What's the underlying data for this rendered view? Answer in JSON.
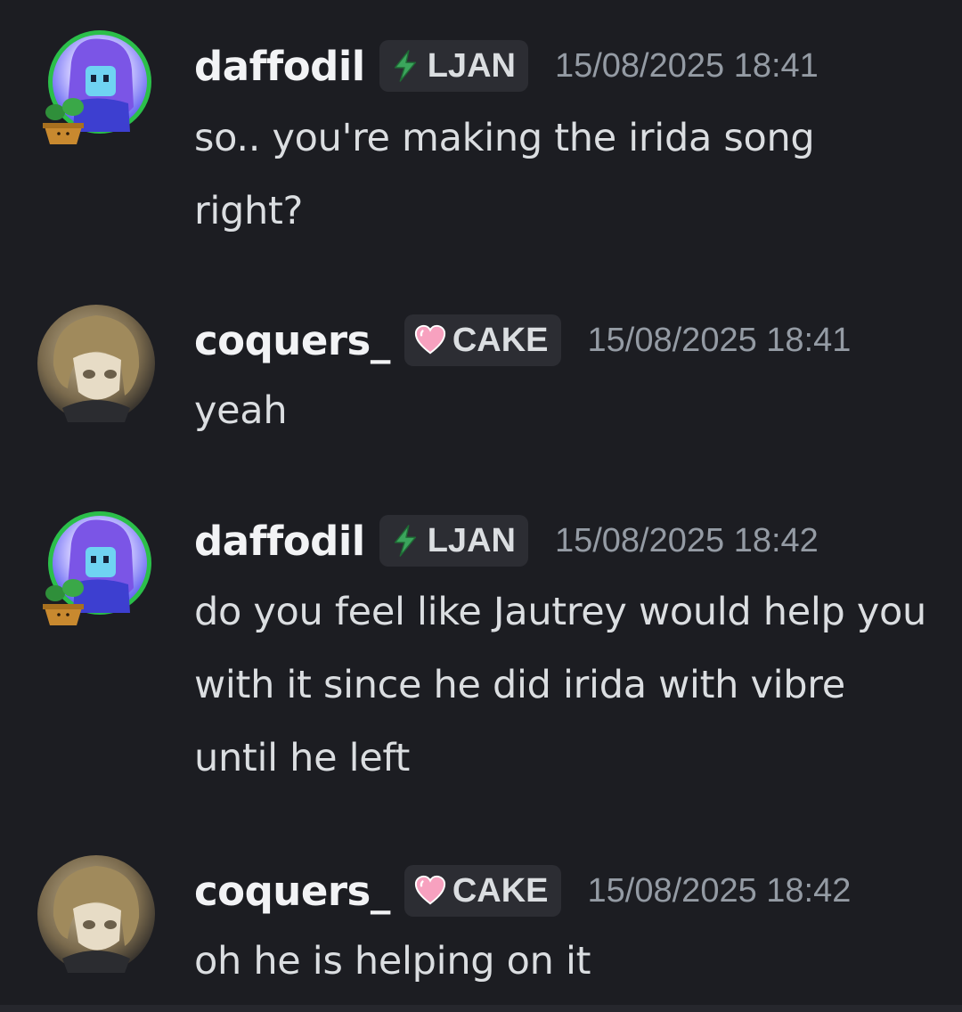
{
  "messages": [
    {
      "username": "daffodil",
      "tag": "LJAN",
      "tag_icon": "lightning-bolt-icon",
      "timestamp": "15/08/2025 18:41",
      "text": "so.. you're making the irida song right?",
      "avatar": "pixel-art-avatar"
    },
    {
      "username": "coquers_",
      "tag": "CAKE",
      "tag_icon": "pink-heart-icon",
      "timestamp": "15/08/2025 18:41",
      "text": "yeah",
      "avatar": "anime-avatar"
    },
    {
      "username": "daffodil",
      "tag": "LJAN",
      "tag_icon": "lightning-bolt-icon",
      "timestamp": "15/08/2025 18:42",
      "text": "do you feel like Jautrey would help you with it since he did irida with vibre until he left",
      "avatar": "pixel-art-avatar"
    },
    {
      "username": "coquers_",
      "tag": "CAKE",
      "tag_icon": "pink-heart-icon",
      "timestamp": "15/08/2025 18:42",
      "text": "oh he is helping on it",
      "avatar": "anime-avatar"
    }
  ],
  "colors": {
    "background": "#1c1d22",
    "username": "#f2f3f5",
    "message_text": "#dbdee1",
    "timestamp": "#949ba4",
    "tag_background": "#2c2d33",
    "lightning_green": "#3ba55c",
    "heart_pink": "#f47fa8"
  }
}
